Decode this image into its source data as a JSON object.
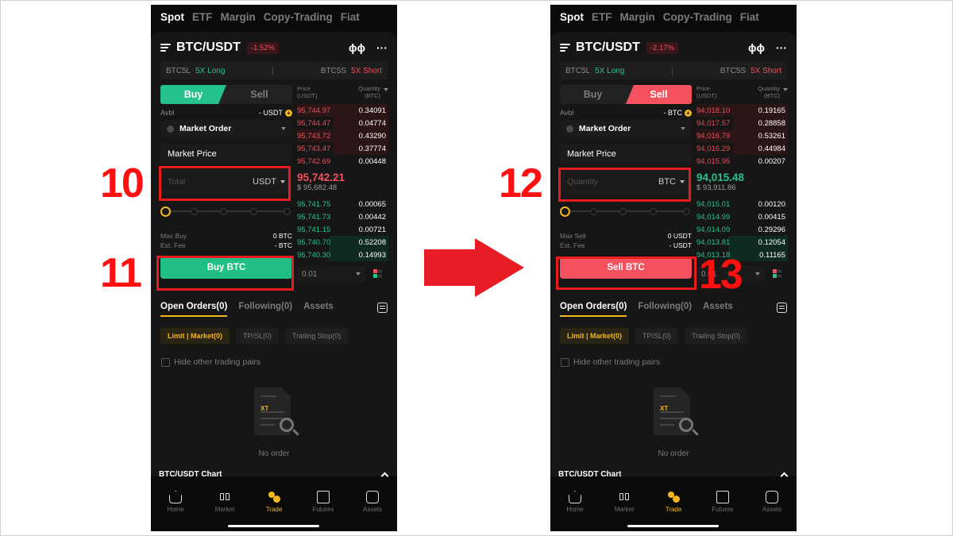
{
  "steps": [
    "10",
    "11",
    "12",
    "13"
  ],
  "phones": [
    {
      "top_tabs": [
        "Spot",
        "ETF",
        "Margin",
        "Copy-Trading",
        "Fiat"
      ],
      "active_top_tab": "Spot",
      "pair": "BTC/USDT",
      "change": "-1.52%",
      "leverage": {
        "long_symbol": "BTC5L",
        "long_label": "5X Long",
        "short_symbol": "BTC5S",
        "short_label": "5X Short"
      },
      "side_buttons": {
        "buy": "Buy",
        "sell": "Sell"
      },
      "active_side": "buy",
      "avbl_label": "Avbl",
      "avbl_value": "- USDT",
      "order_type": "Market Order",
      "market_price": "Market Price",
      "amount_placeholder": "Total",
      "amount_unit": "USDT",
      "max_label": "Max Buy",
      "max_value": "0 BTC",
      "fee_label": "Est. Fee",
      "fee_value": "- BTC",
      "action_button": "Buy BTC",
      "book_header": {
        "price": "Price",
        "price_unit": "(USDT)",
        "qty": "Quantity",
        "qty_unit": "(BTC)"
      },
      "asks": [
        {
          "price": "95,744.97",
          "qty": "0.34091"
        },
        {
          "price": "95,744.47",
          "qty": "0.04774"
        },
        {
          "price": "95,743.72",
          "qty": "0.43290"
        },
        {
          "price": "95,743.47",
          "qty": "0.37774"
        },
        {
          "price": "95,742.69",
          "qty": "0.00448"
        }
      ],
      "last_price": "95,742.21",
      "last_direction": "down",
      "fiat_price": "$ 95,682.48",
      "bids": [
        {
          "price": "95,741.75",
          "qty": "0.00065"
        },
        {
          "price": "95,741.73",
          "qty": "0.00442"
        },
        {
          "price": "95,741.15",
          "qty": "0.00721"
        },
        {
          "price": "95,740.70",
          "qty": "0.52208"
        },
        {
          "price": "95,740.30",
          "qty": "0.14993"
        }
      ],
      "depth": "0.01",
      "orders_tabs": [
        "Open Orders(0)",
        "Following(0)",
        "Assets"
      ],
      "sub_tabs": [
        "Limit | Market(0)",
        "TP/SL(0)",
        "Trailing Stop(0)"
      ],
      "hide_pairs": "Hide other trading pairs",
      "empty_text": "No order",
      "empty_logo": "XT",
      "chart_label": "BTC/USDT Chart",
      "nav": [
        "Home",
        "Market",
        "Trade",
        "Futures",
        "Assets"
      ],
      "active_nav": "Trade"
    },
    {
      "top_tabs": [
        "Spot",
        "ETF",
        "Margin",
        "Copy-Trading",
        "Fiat"
      ],
      "active_top_tab": "Spot",
      "pair": "BTC/USDT",
      "change": "-2.17%",
      "leverage": {
        "long_symbol": "BTC5L",
        "long_label": "5X Long",
        "short_symbol": "BTC5S",
        "short_label": "5X Short"
      },
      "side_buttons": {
        "buy": "Buy",
        "sell": "Sell"
      },
      "active_side": "sell",
      "avbl_label": "Avbl",
      "avbl_value": "- BTC",
      "order_type": "Market Order",
      "market_price": "Market Price",
      "amount_placeholder": "Quantity",
      "amount_unit": "BTC",
      "max_label": "Max Sell",
      "max_value": "0 USDT",
      "fee_label": "Est. Fee",
      "fee_value": "- USDT",
      "action_button": "Sell BTC",
      "book_header": {
        "price": "Price",
        "price_unit": "(USDT)",
        "qty": "Quantity",
        "qty_unit": "(BTC)"
      },
      "asks": [
        {
          "price": "94,018.10",
          "qty": "0.19165"
        },
        {
          "price": "94,017.57",
          "qty": "0.28858"
        },
        {
          "price": "94,016.79",
          "qty": "0.53261"
        },
        {
          "price": "94,016.29",
          "qty": "0.44984"
        },
        {
          "price": "94,015.95",
          "qty": "0.00207"
        }
      ],
      "last_price": "94,015.48",
      "last_direction": "up",
      "fiat_price": "$ 93,911.86",
      "bids": [
        {
          "price": "94,015.01",
          "qty": "0.00120"
        },
        {
          "price": "94,014.99",
          "qty": "0.00415"
        },
        {
          "price": "94,014.09",
          "qty": "0.29296"
        },
        {
          "price": "94,013.81",
          "qty": "0.12054"
        },
        {
          "price": "94,013.18",
          "qty": "0.11165"
        }
      ],
      "depth": "0.01",
      "orders_tabs": [
        "Open Orders(0)",
        "Following(0)",
        "Assets"
      ],
      "sub_tabs": [
        "Limit | Market(0)",
        "TP/SL(0)",
        "Trailing Stop(0)"
      ],
      "hide_pairs": "Hide other trading pairs",
      "empty_text": "No order",
      "empty_logo": "XT",
      "chart_label": "BTC/USDT Chart",
      "nav": [
        "Home",
        "Market",
        "Trade",
        "Futures",
        "Assets"
      ],
      "active_nav": "Trade"
    }
  ],
  "colors": {
    "buy": "#1fbf86",
    "sell": "#f5515e",
    "accent": "#f3b61f",
    "annotation": "#e81c1c"
  }
}
